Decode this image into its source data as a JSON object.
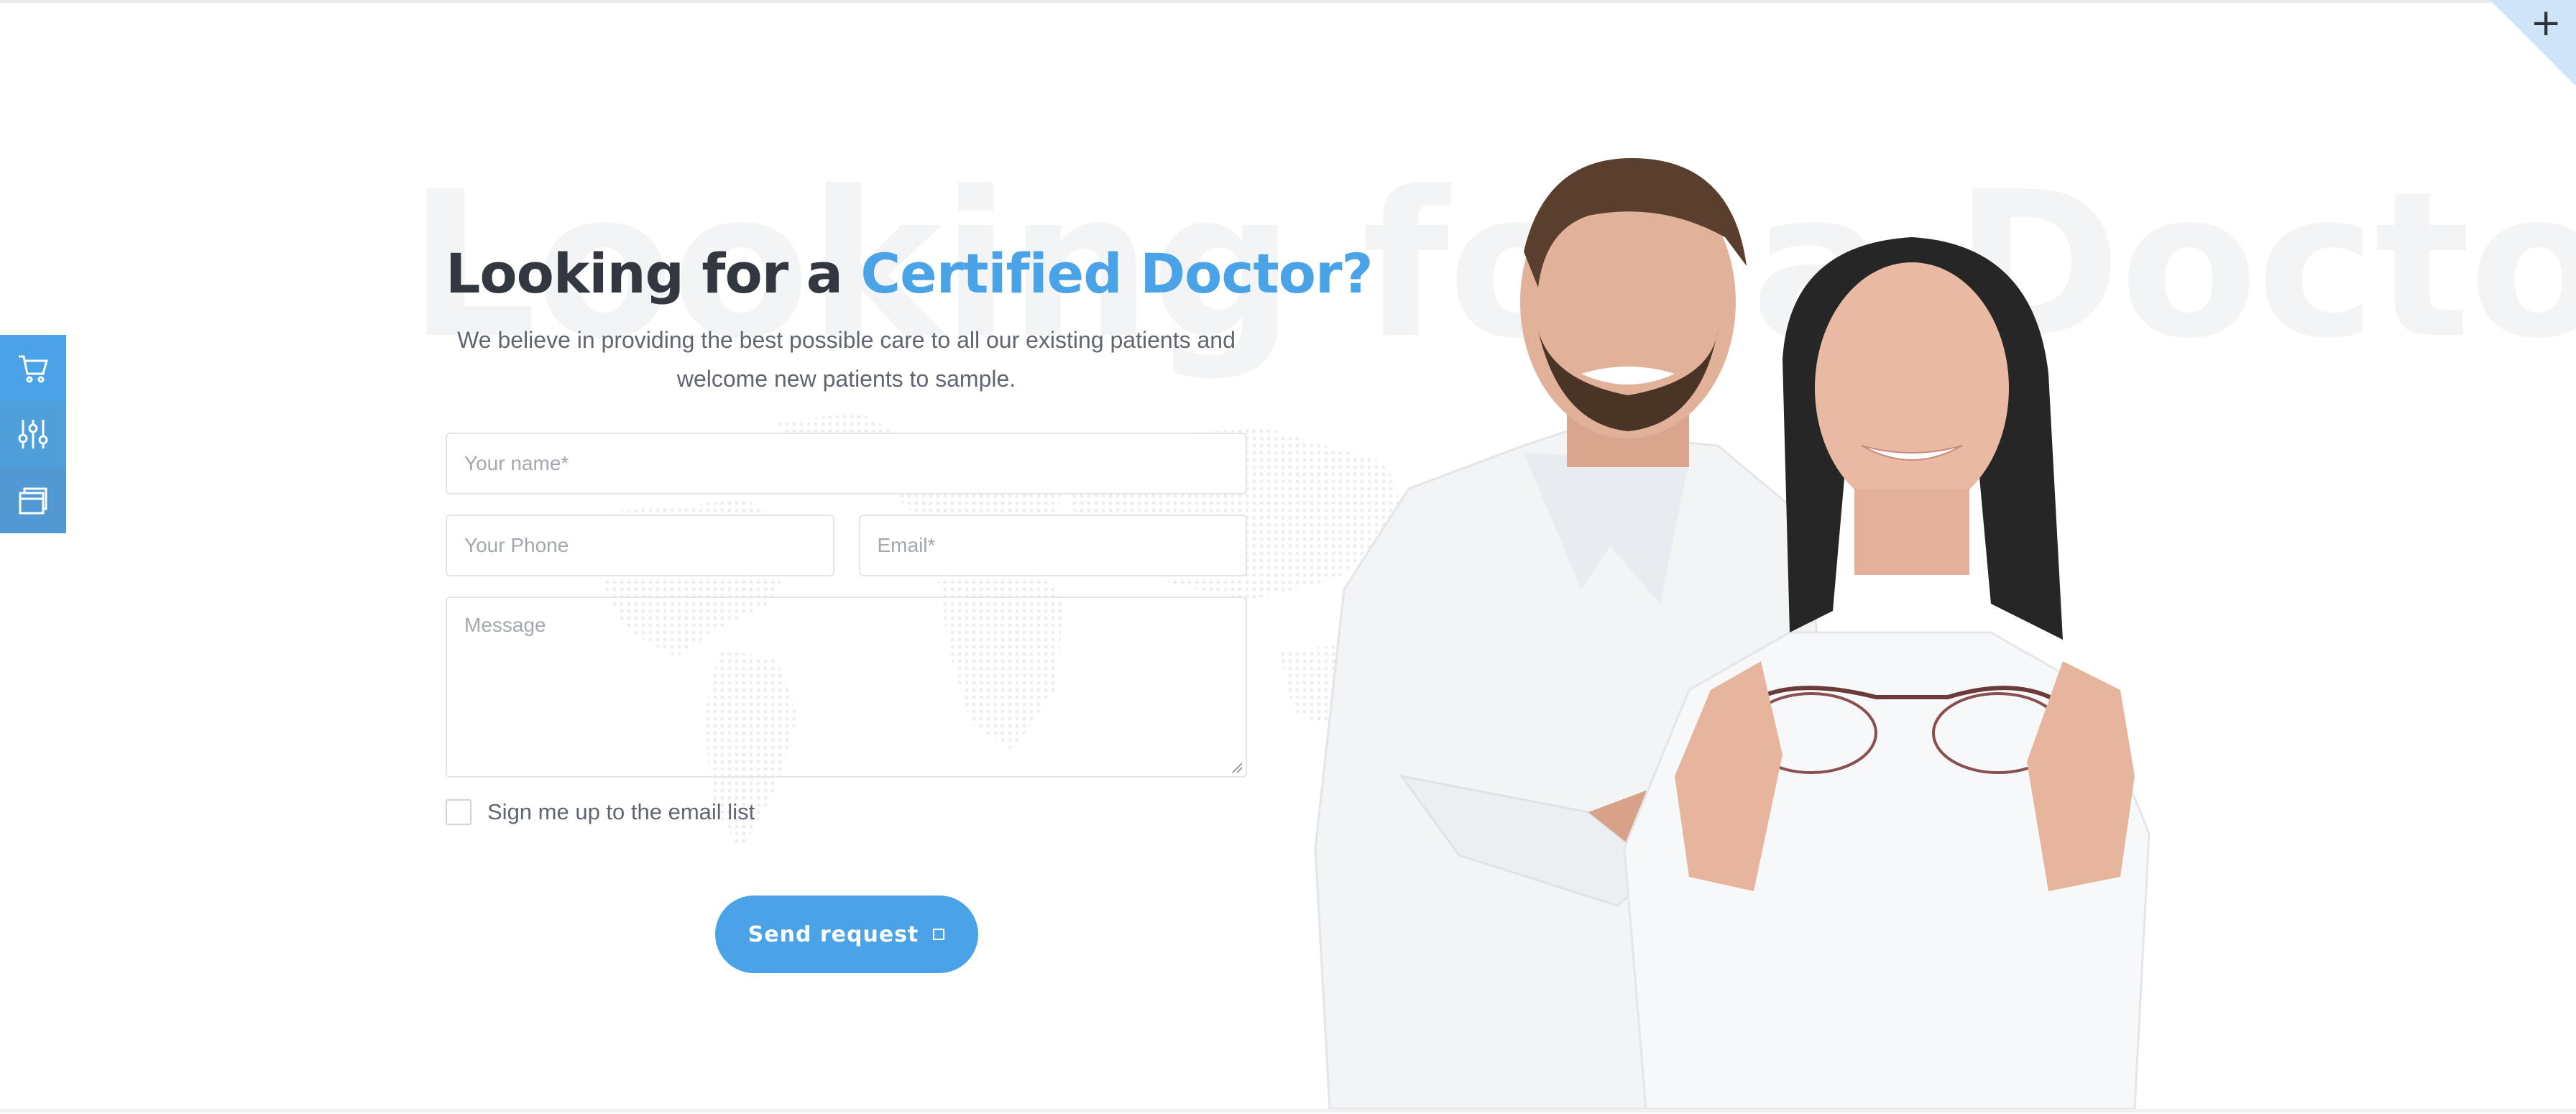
{
  "corner": {
    "symbol": "+"
  },
  "side_toolbar": [
    {
      "icon": "cart-icon"
    },
    {
      "icon": "sliders-icon"
    },
    {
      "icon": "layers-icon"
    }
  ],
  "watermark": "Looking for a Doctor?",
  "headline": {
    "lead": "Looking for a ",
    "accent": "Certified Doctor?"
  },
  "subtitle": "We believe in providing the best possible care to all our existing patients and welcome new patients to sample.",
  "form": {
    "name_placeholder": "Your name*",
    "phone_placeholder": "Your Phone",
    "email_placeholder": "Email*",
    "message_placeholder": "Message",
    "checkbox_label": "Sign me up to the email list",
    "submit_label": "Send request"
  },
  "colors": {
    "accent": "#4aa3e6",
    "heading": "#333840",
    "text": "#5f6670"
  }
}
